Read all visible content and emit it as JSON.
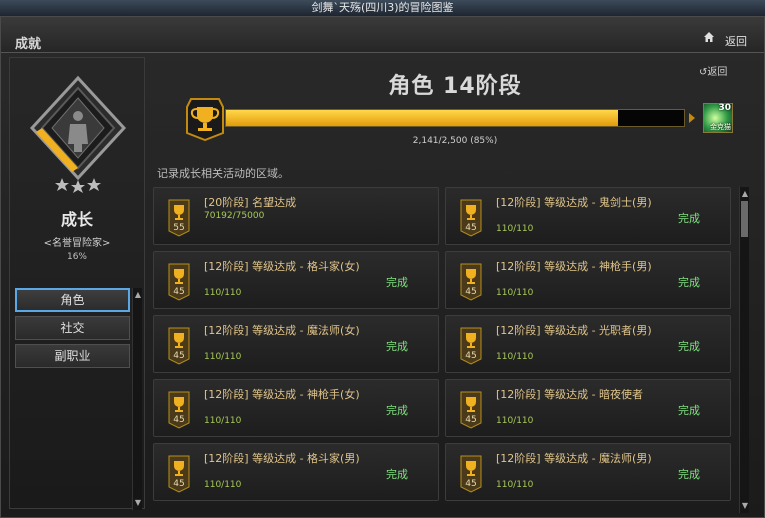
{
  "window_title": "剑舞`天殇(四川3)的冒险图鉴",
  "header": {
    "title": "成就",
    "back_label": "返回"
  },
  "left_panel": {
    "category_name": "成长",
    "category_subtitle": "<名誉冒险家>",
    "percent": "16%",
    "nav": [
      {
        "label": "角色",
        "active": true
      },
      {
        "label": "社交",
        "active": false
      },
      {
        "label": "副职业",
        "active": false
      }
    ]
  },
  "main": {
    "stage_title": "角色 14阶段",
    "back_label": "返回",
    "progress": {
      "current": 2141,
      "total": 2500,
      "fraction": 0.856,
      "text": "2,141/2,500 (85%)"
    },
    "reward": {
      "count": "30",
      "label": "金克猫"
    },
    "description": "记录成长相关活动的区域。",
    "colors": {
      "accent": "#f0b020",
      "complete": "#7fe07f"
    },
    "achievements": [
      {
        "title": "[20阶段] 名望达成",
        "progress": "70192/75000",
        "badge": "55",
        "status": ""
      },
      {
        "title": "[12阶段] 等级达成 - 鬼剑士(男)",
        "progress": "110/110",
        "badge": "45",
        "status": "完成"
      },
      {
        "title": "[12阶段] 等级达成 - 格斗家(女)",
        "progress": "110/110",
        "badge": "45",
        "status": "完成"
      },
      {
        "title": "[12阶段] 等级达成 - 神枪手(男)",
        "progress": "110/110",
        "badge": "45",
        "status": "完成"
      },
      {
        "title": "[12阶段] 等级达成 - 魔法师(女)",
        "progress": "110/110",
        "badge": "45",
        "status": "完成"
      },
      {
        "title": "[12阶段] 等级达成 - 光职者(男)",
        "progress": "110/110",
        "badge": "45",
        "status": "完成"
      },
      {
        "title": "[12阶段] 等级达成 - 神枪手(女)",
        "progress": "110/110",
        "badge": "45",
        "status": "完成"
      },
      {
        "title": "[12阶段] 等级达成 - 暗夜使者",
        "progress": "110/110",
        "badge": "45",
        "status": "完成"
      },
      {
        "title": "[12阶段] 等级达成 - 格斗家(男)",
        "progress": "110/110",
        "badge": "45",
        "status": "完成"
      },
      {
        "title": "[12阶段] 等级达成 - 魔法师(男)",
        "progress": "110/110",
        "badge": "45",
        "status": "完成"
      }
    ]
  }
}
